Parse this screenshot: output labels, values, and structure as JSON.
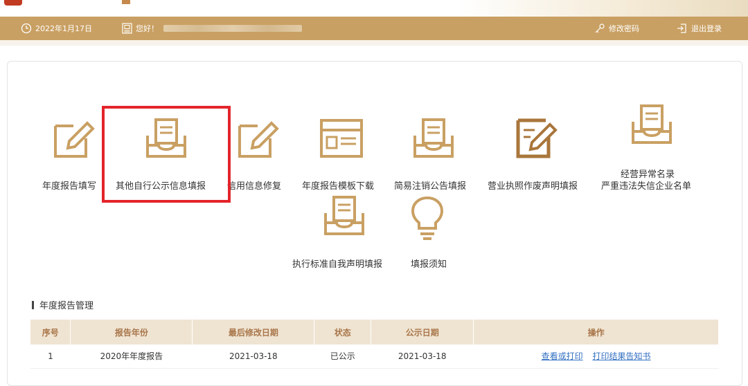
{
  "topbar": {
    "date": "2022年1月17日",
    "greeting": "您好！",
    "change_password": "修改密码",
    "logout": "退出登录"
  },
  "tiles": [
    {
      "label": "年度报告填写",
      "icon": "edit-icon"
    },
    {
      "label": "其他自行公示信息填报",
      "icon": "inbox-icon"
    },
    {
      "label": "信用信息修复",
      "icon": "edit-icon"
    },
    {
      "label": "年度报告模板下载",
      "icon": "template-icon"
    },
    {
      "label": "简易注销公告填报",
      "icon": "inbox-icon"
    },
    {
      "label": "营业执照作废声明填报",
      "icon": "document-edit-icon"
    },
    {
      "label": "经营异常名录",
      "label2": "严重违法失信企业名单",
      "icon": "inbox-icon"
    },
    {
      "label": "执行标准自我声明填报",
      "icon": "inbox-icon"
    },
    {
      "label": "填报须知",
      "icon": "lightbulb-icon"
    }
  ],
  "section": {
    "title": "年度报告管理"
  },
  "table": {
    "headers": [
      "序号",
      "报告年份",
      "最后修改日期",
      "状态",
      "公示日期",
      "操作"
    ],
    "rows": [
      {
        "no": "1",
        "year": "2020年年度报告",
        "modified": "2021-03-18",
        "status": "已公示",
        "published": "2021-03-18",
        "action_view": "查看或打印",
        "action_print": "打印结果告知书"
      }
    ]
  },
  "colors": {
    "accent": "#c9a063",
    "highlight": "#e3242b",
    "link": "#3470c2"
  }
}
